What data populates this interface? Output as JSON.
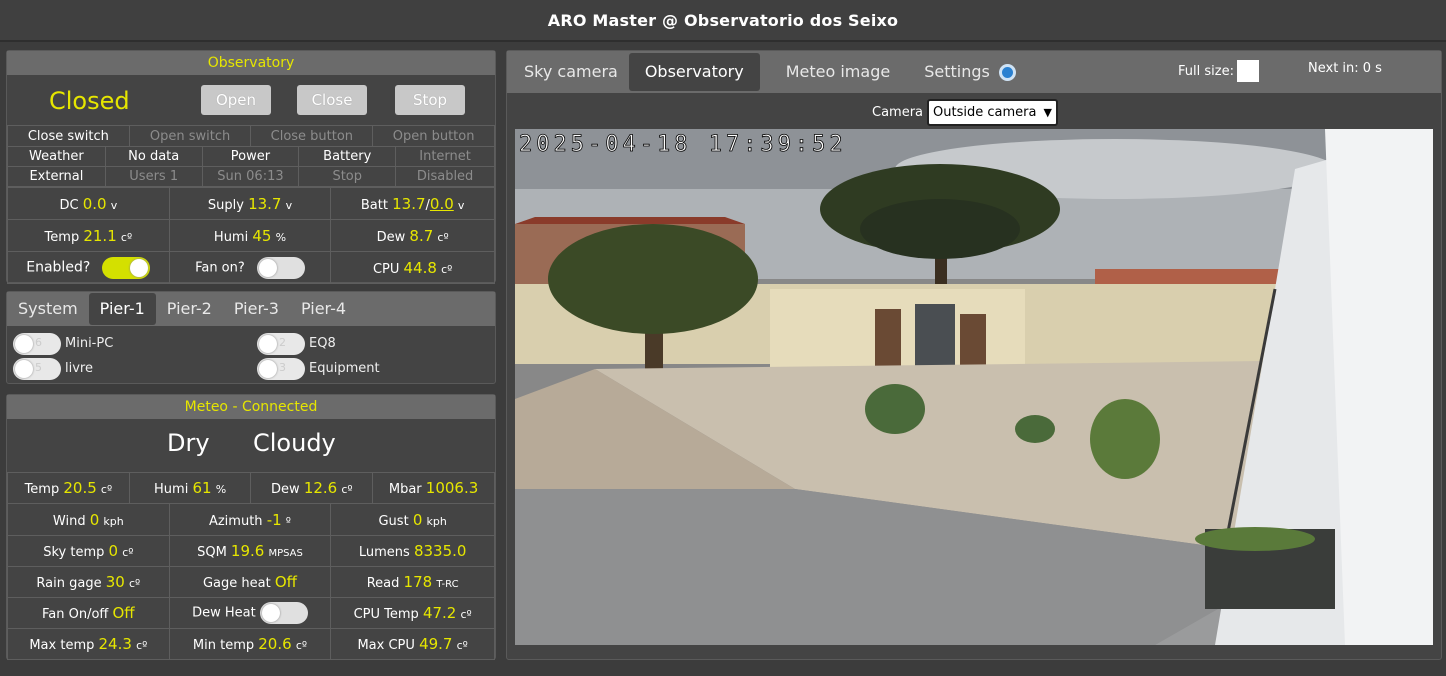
{
  "header": {
    "title": "ARO Master @ Observatorio dos Seixo"
  },
  "observatory": {
    "title": "Observatory",
    "status": "Closed",
    "buttons": {
      "open": "Open",
      "close": "Close",
      "stop": "Stop"
    },
    "row1": [
      "Close switch",
      "Open switch",
      "Close button",
      "Open button"
    ],
    "row2": [
      "Weather",
      "No data",
      "Power",
      "Battery",
      "Internet"
    ],
    "row3": [
      "External",
      "Users 1",
      "Sun 06:13",
      "Stop",
      "Disabled"
    ],
    "dc": {
      "label": "DC",
      "value": "0.0",
      "unit": "v"
    },
    "suply": {
      "label": "Suply",
      "value": "13.7",
      "unit": "v"
    },
    "batt": {
      "label": "Batt",
      "value": "13.7",
      "sep": "/",
      "value2": "0.0",
      "unit": "v"
    },
    "temp": {
      "label": "Temp",
      "value": "21.1",
      "unit": "cº"
    },
    "humi": {
      "label": "Humi",
      "value": "45",
      "unit": "%"
    },
    "dew": {
      "label": "Dew",
      "value": "8.7",
      "unit": "cº"
    },
    "enabled": {
      "label": "Enabled?",
      "on": true
    },
    "fan": {
      "label": "Fan on?",
      "on": false
    },
    "cpu": {
      "label": "CPU",
      "value": "44.8",
      "unit": "cº"
    }
  },
  "piers": {
    "tabs": [
      "System",
      "Pier-1",
      "Pier-2",
      "Pier-3",
      "Pier-4"
    ],
    "active": "Pier-1",
    "switches": [
      {
        "num": "6",
        "label": "Mini-PC"
      },
      {
        "num": "2",
        "label": "EQ8"
      },
      {
        "num": "5",
        "label": "livre"
      },
      {
        "num": "3",
        "label": "Equipment"
      }
    ]
  },
  "meteo": {
    "title": "Meteo - Connected",
    "cond1": "Dry",
    "cond2": "Cloudy",
    "temp": {
      "label": "Temp",
      "value": "20.5",
      "unit": "cº"
    },
    "humi": {
      "label": "Humi",
      "value": "61",
      "unit": "%"
    },
    "dew": {
      "label": "Dew",
      "value": "12.6",
      "unit": "cº"
    },
    "mbar": {
      "label": "Mbar",
      "value": "1006.3"
    },
    "wind": {
      "label": "Wind",
      "value": "0",
      "unit": "kph"
    },
    "azimuth": {
      "label": "Azimuth",
      "value": "-1",
      "unit": "º"
    },
    "gust": {
      "label": "Gust",
      "value": "0",
      "unit": "kph"
    },
    "skytemp": {
      "label": "Sky temp",
      "value": "0",
      "unit": "cº"
    },
    "sqm": {
      "label": "SQM",
      "value": "19.6",
      "unit": "MPSAS"
    },
    "lumens": {
      "label": "Lumens",
      "value": "8335.0"
    },
    "rain": {
      "label": "Rain gage",
      "value": "30",
      "unit": "cº"
    },
    "gageheat": {
      "label": "Gage heat",
      "value": "Off"
    },
    "read": {
      "label": "Read",
      "value": "178",
      "unit": "T-RC"
    },
    "fanonoff": {
      "label": "Fan On/off",
      "value": "Off"
    },
    "dewheat": {
      "label": "Dew Heat"
    },
    "cputemp": {
      "label": "CPU Temp",
      "value": "47.2",
      "unit": "cº"
    },
    "maxtemp": {
      "label": "Max temp",
      "value": "24.3",
      "unit": "cº"
    },
    "mintemp": {
      "label": "Min temp",
      "value": "20.6",
      "unit": "cº"
    },
    "maxcpu": {
      "label": "Max CPU",
      "value": "49.7",
      "unit": "cº"
    }
  },
  "right": {
    "tabs": [
      "Sky camera",
      "Observatory",
      "Meteo image",
      "Settings"
    ],
    "active": "Observatory",
    "fullsize": "Full size:",
    "next": "Next in: 0 s",
    "camera_label": "Camera",
    "camera_value": "Outside camera",
    "timestamp": "2025-04-18  17:39:52"
  }
}
